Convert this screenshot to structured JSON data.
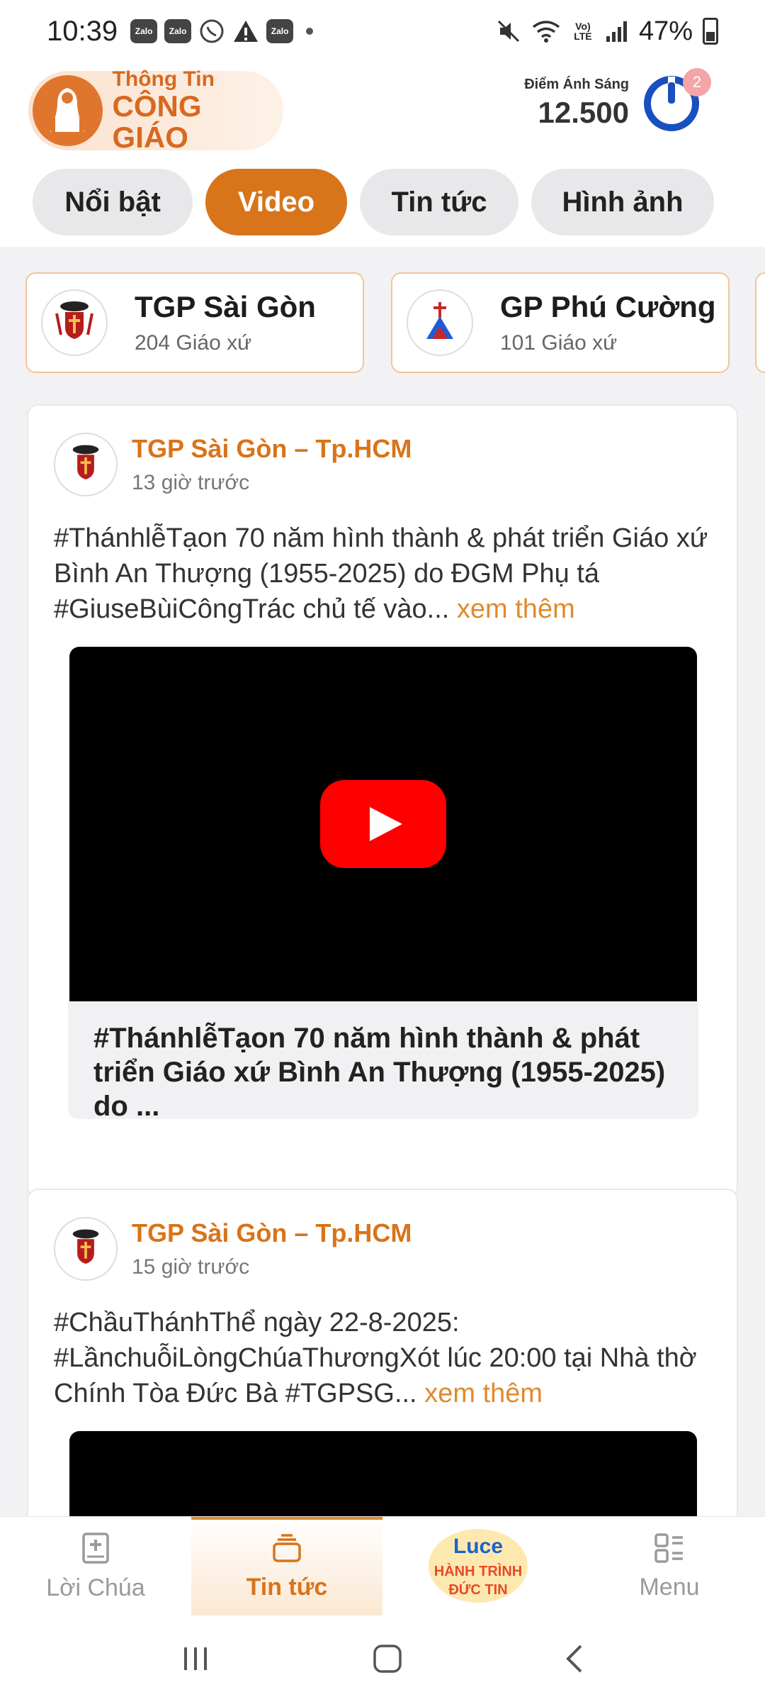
{
  "status_bar": {
    "time": "10:39",
    "notification_icons": [
      "zalo-icon",
      "zalo-icon",
      "viber-icon",
      "warning-icon",
      "zalo-icon"
    ],
    "zalo_label": "Zalo",
    "network_label": "Vo) LTE",
    "battery": "47%"
  },
  "header": {
    "logo_line1": "Thông Tin",
    "logo_line2": "CÔNG GIÁO",
    "points_label": "Điểm Ánh Sáng",
    "points_value": "12.500",
    "notification_count": "2"
  },
  "tabs": [
    {
      "label": "Nổi bật",
      "active": false
    },
    {
      "label": "Video",
      "active": true
    },
    {
      "label": "Tin tức",
      "active": false
    },
    {
      "label": "Hình ảnh",
      "active": false
    }
  ],
  "dioceses": [
    {
      "name": "TGP Sài Gòn",
      "count": "204 Giáo xứ"
    },
    {
      "name": "GP Phú Cường",
      "count": "101 Giáo xứ"
    }
  ],
  "posts": [
    {
      "author": "TGP Sài Gòn – Tp.HCM",
      "time": "13 giờ trước",
      "text": "#ThánhlễTạon 70 năm hình thành & phát triển Giáo xứ Bình An Thượng (1955-2025) do ĐGM Phụ tá #GiuseBùiCôngTrác chủ tế vào...",
      "see_more": "xem thêm",
      "video_title": "#ThánhlễTạon 70 năm hình thành & phát triển Giáo xứ Bình An Thượng (1955-2025) do ..."
    },
    {
      "author": "TGP Sài Gòn – Tp.HCM",
      "time": "15 giờ trước",
      "text": "#ChầuThánhThể ngày 22-8-2025: #LầnchuỗiLòngChúaThươngXót lúc 20:00 tại Nhà thờ Chính Tòa Đức Bà #TGPSG...",
      "see_more": "xem thêm"
    }
  ],
  "bottom_nav": [
    {
      "label": "Lời Chúa",
      "icon": "bible-icon",
      "active": false
    },
    {
      "label": "Tin tức",
      "icon": "news-stack-icon",
      "active": true
    },
    {
      "label": "",
      "icon": "luce-hanh-trinh-duc-tin-logo",
      "active": false
    },
    {
      "label": "Menu",
      "icon": "menu-grid-icon",
      "active": false
    }
  ],
  "luce_logo": {
    "line1": "Luce",
    "line2": "HÀNH TRÌNH",
    "line3": "ĐỨC TIN"
  },
  "colors": {
    "accent": "#d8741a",
    "tab_inactive": "#e8e8ea",
    "feed_bg": "#f2f2f4",
    "youtube_red": "#ff0000"
  }
}
